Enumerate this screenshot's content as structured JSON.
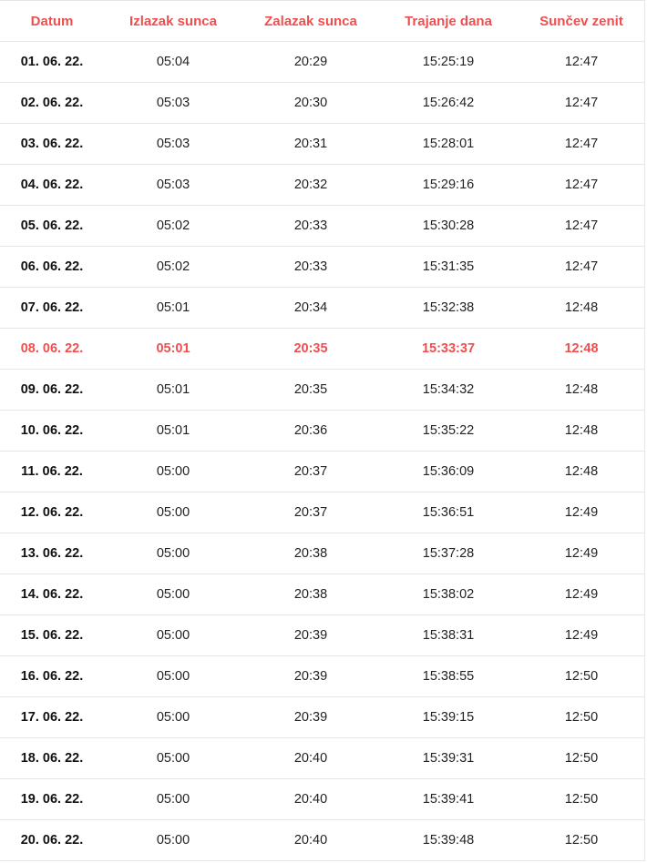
{
  "headers": [
    "Datum",
    "Izlazak sunca",
    "Zalazak sunca",
    "Trajanje dana",
    "Sunčev zenit"
  ],
  "highlight_color": "#f04e4e",
  "highlight_row": 7,
  "rows": [
    [
      "01. 06. 22.",
      "05:04",
      "20:29",
      "15:25:19",
      "12:47"
    ],
    [
      "02. 06. 22.",
      "05:03",
      "20:30",
      "15:26:42",
      "12:47"
    ],
    [
      "03. 06. 22.",
      "05:03",
      "20:31",
      "15:28:01",
      "12:47"
    ],
    [
      "04. 06. 22.",
      "05:03",
      "20:32",
      "15:29:16",
      "12:47"
    ],
    [
      "05. 06. 22.",
      "05:02",
      "20:33",
      "15:30:28",
      "12:47"
    ],
    [
      "06. 06. 22.",
      "05:02",
      "20:33",
      "15:31:35",
      "12:47"
    ],
    [
      "07. 06. 22.",
      "05:01",
      "20:34",
      "15:32:38",
      "12:48"
    ],
    [
      "08. 06. 22.",
      "05:01",
      "20:35",
      "15:33:37",
      "12:48"
    ],
    [
      "09. 06. 22.",
      "05:01",
      "20:35",
      "15:34:32",
      "12:48"
    ],
    [
      "10. 06. 22.",
      "05:01",
      "20:36",
      "15:35:22",
      "12:48"
    ],
    [
      "11. 06. 22.",
      "05:00",
      "20:37",
      "15:36:09",
      "12:48"
    ],
    [
      "12. 06. 22.",
      "05:00",
      "20:37",
      "15:36:51",
      "12:49"
    ],
    [
      "13. 06. 22.",
      "05:00",
      "20:38",
      "15:37:28",
      "12:49"
    ],
    [
      "14. 06. 22.",
      "05:00",
      "20:38",
      "15:38:02",
      "12:49"
    ],
    [
      "15. 06. 22.",
      "05:00",
      "20:39",
      "15:38:31",
      "12:49"
    ],
    [
      "16. 06. 22.",
      "05:00",
      "20:39",
      "15:38:55",
      "12:50"
    ],
    [
      "17. 06. 22.",
      "05:00",
      "20:39",
      "15:39:15",
      "12:50"
    ],
    [
      "18. 06. 22.",
      "05:00",
      "20:40",
      "15:39:31",
      "12:50"
    ],
    [
      "19. 06. 22.",
      "05:00",
      "20:40",
      "15:39:41",
      "12:50"
    ],
    [
      "20. 06. 22.",
      "05:00",
      "20:40",
      "15:39:48",
      "12:50"
    ]
  ]
}
